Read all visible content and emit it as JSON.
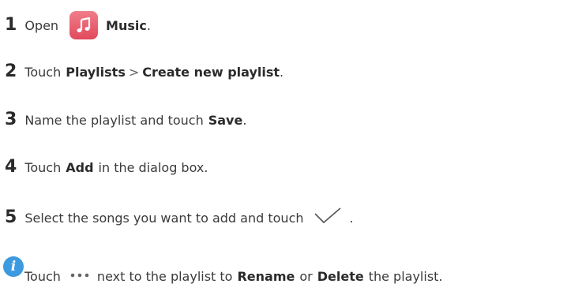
{
  "steps": [
    {
      "number": "1",
      "text_a": "Open",
      "app_name": "Music",
      "text_end": "."
    },
    {
      "number": "2",
      "text_a": "Touch",
      "bold_a": "Playlists",
      "separator": ">",
      "bold_b": "Create new playlist",
      "text_end": "."
    },
    {
      "number": "3",
      "text_a": "Name the playlist and touch",
      "bold_a": "Save",
      "text_end": "."
    },
    {
      "number": "4",
      "text_a": "Touch",
      "bold_a": "Add",
      "text_b": "in the dialog box."
    },
    {
      "number": "5",
      "text_a": "Select the songs you want to add and touch",
      "text_end": "."
    }
  ],
  "note": {
    "text_a": "Touch",
    "text_b": "next to the playlist to",
    "bold_a": "Rename",
    "text_c": "or",
    "bold_b": "Delete",
    "text_d": "the playlist."
  },
  "icons": {
    "music_app": "music-note-icon",
    "check": "checkmark-icon",
    "info": "info-icon",
    "more": "more-dots-icon"
  },
  "colors": {
    "music_icon": "#e14a5c",
    "info_icon": "#3d9ae0",
    "text": "#3a3a3a"
  }
}
